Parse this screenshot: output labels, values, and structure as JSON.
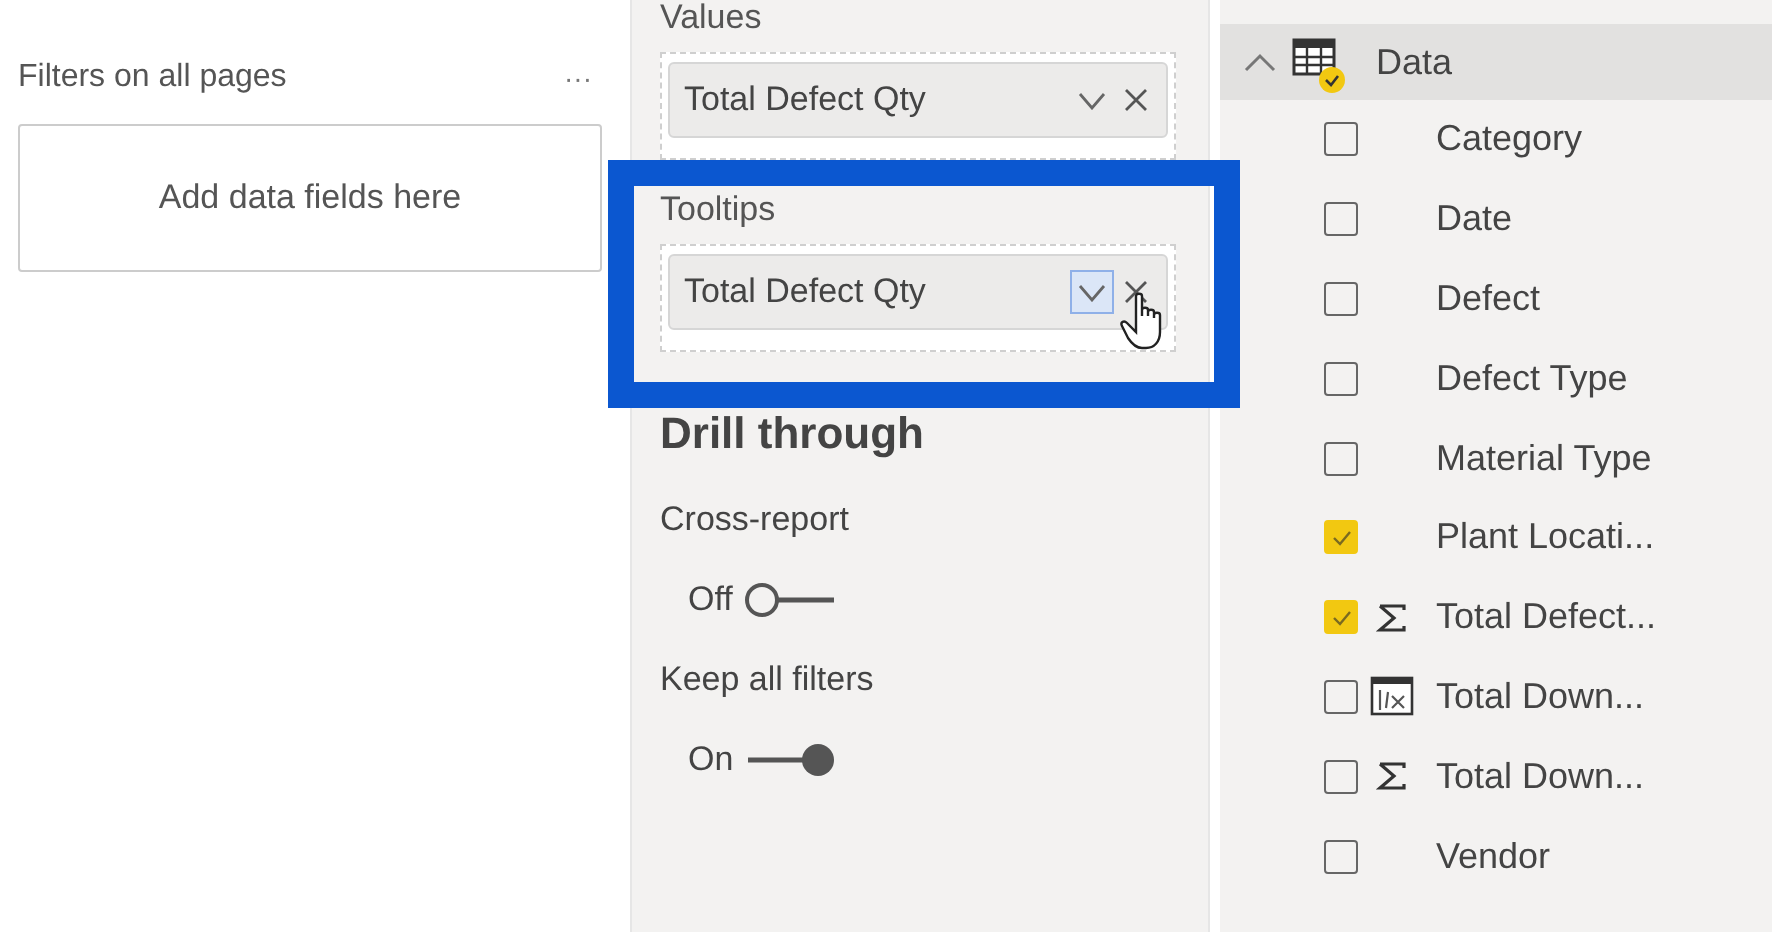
{
  "filters_pane": {
    "title": "Filters on all pages",
    "more": "···",
    "drop_zone": "Add data fields here"
  },
  "fields_wells": [
    {
      "label": "Values",
      "field": "Total Defect Qty",
      "highlighted": false
    },
    {
      "label": "Tooltips",
      "field": "Total Defect Qty",
      "highlighted": true
    }
  ],
  "drill_through": {
    "title": "Drill through",
    "toggles": [
      {
        "label": "Cross-report",
        "state": "Off",
        "on": false
      },
      {
        "label": "Keep all filters",
        "state": "On",
        "on": true
      }
    ]
  },
  "fields_list": {
    "table": {
      "name": "Data",
      "expanded": true
    },
    "fields": [
      {
        "name": "Category",
        "checked": false,
        "kind": "plain"
      },
      {
        "name": "Date",
        "checked": false,
        "kind": "plain"
      },
      {
        "name": "Defect",
        "checked": false,
        "kind": "plain"
      },
      {
        "name": "Defect Type",
        "checked": false,
        "kind": "plain"
      },
      {
        "name": "Material Type",
        "checked": false,
        "kind": "plain"
      },
      {
        "name": "Plant Locati...",
        "checked": true,
        "kind": "plain"
      },
      {
        "name": "Total Defect...",
        "checked": true,
        "kind": "sum"
      },
      {
        "name": "Total Down...",
        "checked": false,
        "kind": "calc"
      },
      {
        "name": "Total Down...",
        "checked": false,
        "kind": "sum"
      },
      {
        "name": "Vendor",
        "checked": false,
        "kind": "plain"
      }
    ]
  }
}
